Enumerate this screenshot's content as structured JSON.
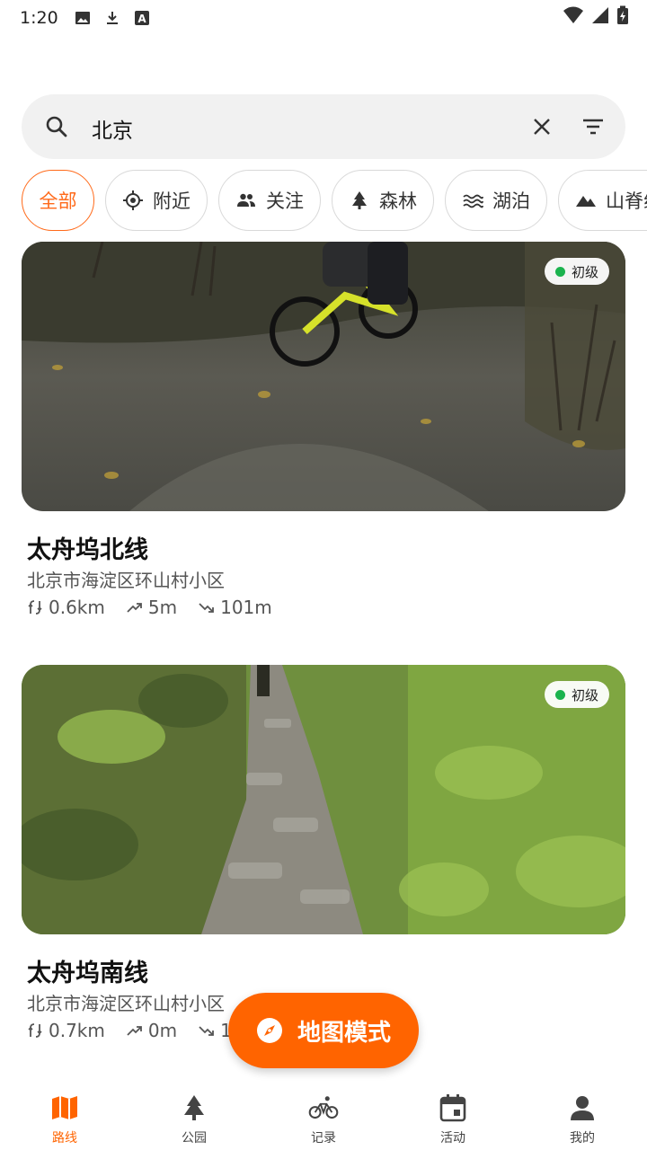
{
  "status_bar": {
    "time": "1:20",
    "icons": [
      "image-icon",
      "download-icon",
      "font-icon"
    ],
    "right_icons": [
      "wifi-icon",
      "signal-icon",
      "battery-charging-icon"
    ]
  },
  "search": {
    "value": "北京",
    "icons": [
      "search-icon",
      "close-icon",
      "filter-icon"
    ]
  },
  "chips": [
    {
      "label": "全部",
      "icon": "",
      "active": true
    },
    {
      "label": "附近",
      "icon": "location-target-icon",
      "active": false
    },
    {
      "label": "关注",
      "icon": "people-icon",
      "active": false
    },
    {
      "label": "森林",
      "icon": "tree-icon",
      "active": false
    },
    {
      "label": "湖泊",
      "icon": "waves-icon",
      "active": false
    },
    {
      "label": "山脊线",
      "icon": "mountain-icon",
      "active": false
    }
  ],
  "routes": [
    {
      "title": "太舟坞北线",
      "address": "北京市海淀区环山村小区",
      "badge": "初级",
      "distance": "0.6km",
      "ascent": "5m",
      "descent": "101m"
    },
    {
      "title": "太舟坞南线",
      "address": "北京市海淀区环山村小区",
      "badge": "初级",
      "distance": "0.7km",
      "ascent": "0m",
      "descent": "1"
    }
  ],
  "fab": {
    "label": "地图模式",
    "icon": "compass-icon"
  },
  "bottom_nav": [
    {
      "label": "路线",
      "icon": "map-icon",
      "active": true
    },
    {
      "label": "公园",
      "icon": "tree-icon",
      "active": false
    },
    {
      "label": "记录",
      "icon": "bike-icon",
      "active": false
    },
    {
      "label": "活动",
      "icon": "calendar-icon",
      "active": false
    },
    {
      "label": "我的",
      "icon": "person-icon",
      "active": false
    }
  ],
  "colors": {
    "accent": "#ff6400",
    "badge_dot": "#1bb34e"
  }
}
